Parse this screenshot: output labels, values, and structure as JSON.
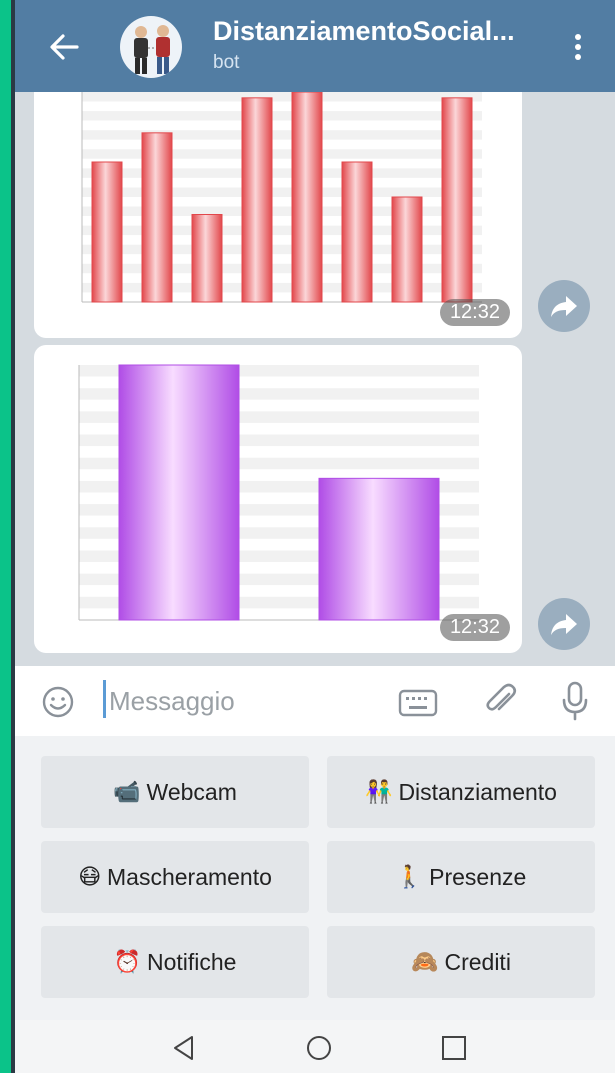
{
  "header": {
    "title": "DistanziamentoSocial...",
    "subtitle": "bot"
  },
  "messages": [
    {
      "time": "12:32",
      "chart": {
        "type": "bar",
        "categories": [
          "",
          "",
          "",
          "",
          "",
          "",
          "",
          ""
        ],
        "values": [
          4.8,
          5.8,
          3.0,
          7.0,
          7.2,
          4.8,
          3.6,
          7.0
        ],
        "ylim": [
          0,
          7.2
        ],
        "bar_color": "#e2474b"
      }
    },
    {
      "time": "12:32",
      "chart": {
        "type": "bar",
        "categories": [
          "",
          ""
        ],
        "values": [
          9.0,
          5.0
        ],
        "ylim": [
          0,
          9.0
        ],
        "bar_color": "#b04de6"
      }
    }
  ],
  "input": {
    "placeholder": "Messaggio"
  },
  "keyboard": [
    {
      "icon": "📹",
      "label": "Webcam"
    },
    {
      "icon": "👫",
      "label": "Distanziamento"
    },
    {
      "icon": "😷",
      "label": "Mascheramento"
    },
    {
      "icon": "🚶",
      "label": "Presenze"
    },
    {
      "icon": "⏰",
      "label": "Notifiche"
    },
    {
      "icon": "🙈",
      "label": "Crediti"
    }
  ],
  "colors": {
    "header": "#527da3",
    "accent_left": "#0bc389",
    "chat_bg": "#d5dbe0"
  }
}
